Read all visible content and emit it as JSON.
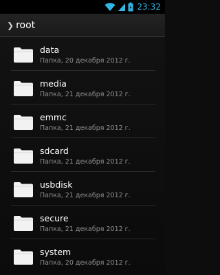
{
  "statusbar": {
    "time": "23:32",
    "icons": [
      "wifi-icon",
      "signal-icon",
      "battery-icon"
    ],
    "accent": "#33b5e5"
  },
  "pathbar": {
    "path": "root"
  },
  "items": [
    {
      "name": "data",
      "date": "Папка, 20 декабря 2012 г."
    },
    {
      "name": "media",
      "date": "Папка, 21 декабря 2012 г."
    },
    {
      "name": "emmc",
      "date": "Папка, 21 декабря 2012 г."
    },
    {
      "name": "sdcard",
      "date": "Папка, 21 декабря 2012 г."
    },
    {
      "name": "usbdisk",
      "date": "Папка, 21 декабря 2012 г."
    },
    {
      "name": "secure",
      "date": "Папка, 21 декабря 2012 г."
    },
    {
      "name": "system",
      "date": "Папка, 20 декабря 2012 г."
    }
  ]
}
